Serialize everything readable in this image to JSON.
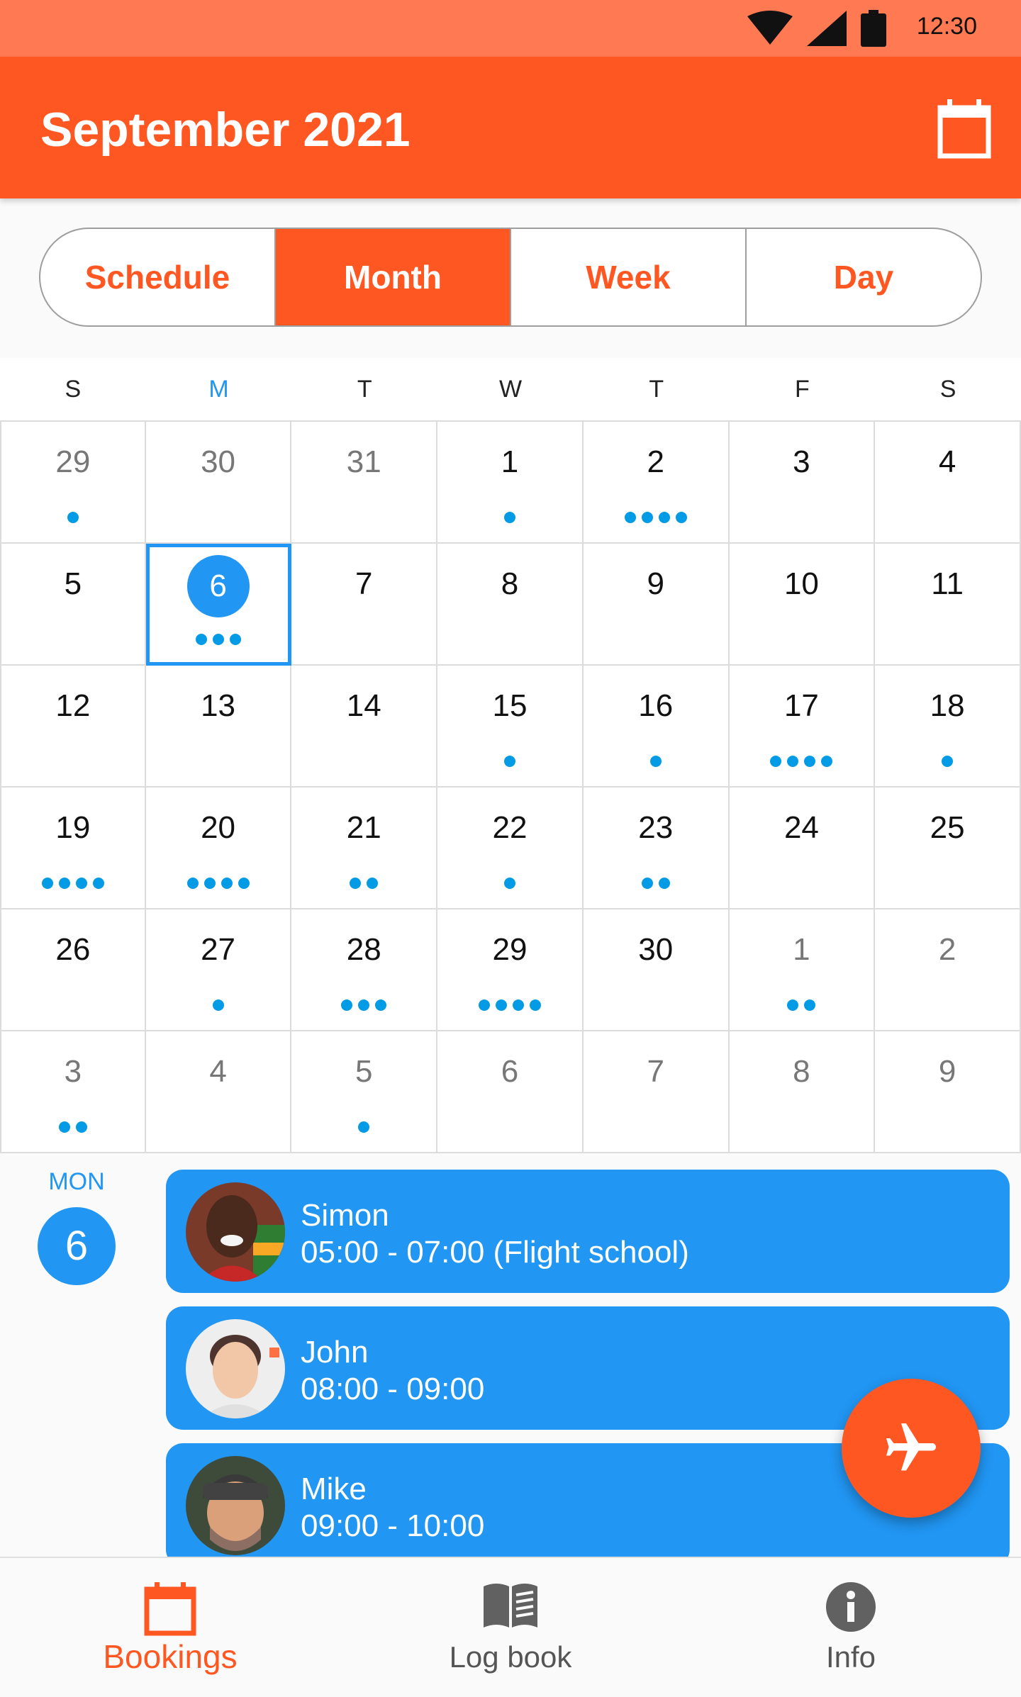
{
  "status_bar": {
    "time": "12:30"
  },
  "app_bar": {
    "title": "September 2021",
    "calendar_icon": "calendar-icon"
  },
  "view_tabs": [
    {
      "label": "Schedule",
      "active": false
    },
    {
      "label": "Month",
      "active": true
    },
    {
      "label": "Week",
      "active": false
    },
    {
      "label": "Day",
      "active": false
    }
  ],
  "calendar": {
    "weekdays": [
      "S",
      "M",
      "T",
      "W",
      "T",
      "F",
      "S"
    ],
    "today_weekday_index": 1,
    "dot_color": "#039be5",
    "days": [
      {
        "d": "29",
        "other": true,
        "dots": 1
      },
      {
        "d": "30",
        "other": true,
        "dots": 0
      },
      {
        "d": "31",
        "other": true,
        "dots": 0
      },
      {
        "d": "1",
        "other": false,
        "dots": 1
      },
      {
        "d": "2",
        "other": false,
        "dots": 4
      },
      {
        "d": "3",
        "other": false,
        "dots": 0
      },
      {
        "d": "4",
        "other": false,
        "dots": 0
      },
      {
        "d": "5",
        "other": false,
        "dots": 0
      },
      {
        "d": "6",
        "other": false,
        "dots": 3,
        "selected": true
      },
      {
        "d": "7",
        "other": false,
        "dots": 0
      },
      {
        "d": "8",
        "other": false,
        "dots": 0
      },
      {
        "d": "9",
        "other": false,
        "dots": 0
      },
      {
        "d": "10",
        "other": false,
        "dots": 0
      },
      {
        "d": "11",
        "other": false,
        "dots": 0
      },
      {
        "d": "12",
        "other": false,
        "dots": 0
      },
      {
        "d": "13",
        "other": false,
        "dots": 0
      },
      {
        "d": "14",
        "other": false,
        "dots": 0
      },
      {
        "d": "15",
        "other": false,
        "dots": 1
      },
      {
        "d": "16",
        "other": false,
        "dots": 1
      },
      {
        "d": "17",
        "other": false,
        "dots": 4
      },
      {
        "d": "18",
        "other": false,
        "dots": 1
      },
      {
        "d": "19",
        "other": false,
        "dots": 4
      },
      {
        "d": "20",
        "other": false,
        "dots": 4
      },
      {
        "d": "21",
        "other": false,
        "dots": 2
      },
      {
        "d": "22",
        "other": false,
        "dots": 1
      },
      {
        "d": "23",
        "other": false,
        "dots": 2
      },
      {
        "d": "24",
        "other": false,
        "dots": 0
      },
      {
        "d": "25",
        "other": false,
        "dots": 0
      },
      {
        "d": "26",
        "other": false,
        "dots": 0
      },
      {
        "d": "27",
        "other": false,
        "dots": 1
      },
      {
        "d": "28",
        "other": false,
        "dots": 3
      },
      {
        "d": "29",
        "other": false,
        "dots": 4
      },
      {
        "d": "30",
        "other": false,
        "dots": 0
      },
      {
        "d": "1",
        "other": true,
        "dots": 2
      },
      {
        "d": "2",
        "other": true,
        "dots": 0
      },
      {
        "d": "3",
        "other": true,
        "dots": 2
      },
      {
        "d": "4",
        "other": true,
        "dots": 0
      },
      {
        "d": "5",
        "other": true,
        "dots": 1
      },
      {
        "d": "6",
        "other": true,
        "dots": 0
      },
      {
        "d": "7",
        "other": true,
        "dots": 0
      },
      {
        "d": "8",
        "other": true,
        "dots": 0
      },
      {
        "d": "9",
        "other": true,
        "dots": 0
      }
    ]
  },
  "selected_day": {
    "weekday": "MON",
    "day": "6"
  },
  "events": [
    {
      "name": "Simon",
      "time": "05:00 - 07:00 (Flight school)",
      "avatar": "avatar-simon"
    },
    {
      "name": "John",
      "time": "08:00 - 09:00",
      "avatar": "avatar-john"
    },
    {
      "name": "Mike",
      "time": "09:00 - 10:00",
      "avatar": "avatar-mike"
    }
  ],
  "fab": {
    "icon": "airplane-icon"
  },
  "bottom_nav": [
    {
      "label": "Bookings",
      "icon": "calendar-icon",
      "active": true
    },
    {
      "label": "Log book",
      "icon": "book-icon",
      "active": false
    },
    {
      "label": "Info",
      "icon": "info-icon",
      "active": false
    }
  ],
  "colors": {
    "primary": "#ff5722",
    "status_bar": "#ff7a52",
    "accent": "#2196f3"
  }
}
